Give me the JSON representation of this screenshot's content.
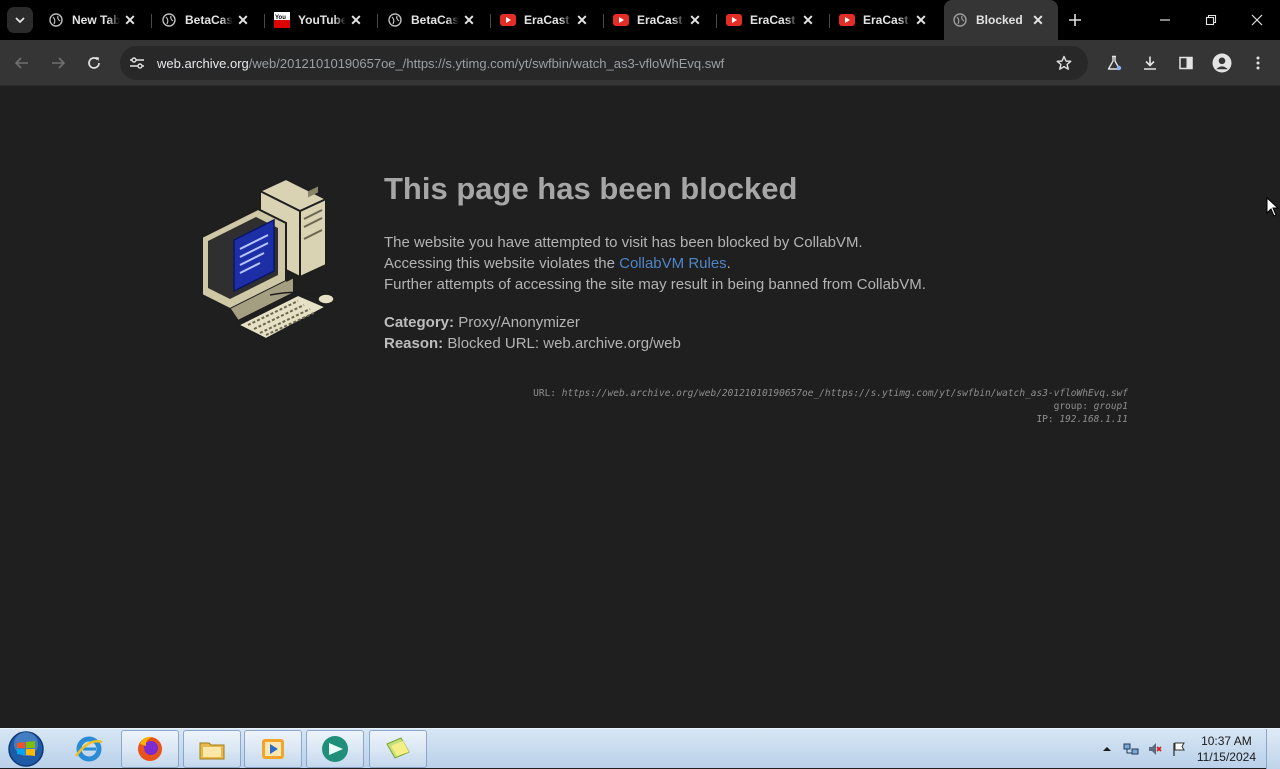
{
  "tabs": [
    {
      "title": "New Tab",
      "favicon": "globe-icon"
    },
    {
      "title": "BetaCast",
      "favicon": "globe-icon"
    },
    {
      "title": "YouTube",
      "favicon": "youtube-logo"
    },
    {
      "title": "BetaCast",
      "favicon": "globe-icon"
    },
    {
      "title": "EraCast",
      "favicon": "youtube-play-icon"
    },
    {
      "title": "EraCast",
      "favicon": "youtube-play-icon"
    },
    {
      "title": "EraCast",
      "favicon": "youtube-play-icon"
    },
    {
      "title": "EraCast",
      "favicon": "youtube-play-icon"
    },
    {
      "title": "Blocked",
      "favicon": "globe-icon",
      "active": true
    }
  ],
  "toolbar": {
    "url_host": "web.archive.org",
    "url_path": "/web/20121010190657oe_/https://s.ytimg.com/yt/swfbin/watch_as3-vfloWhEvq.swf"
  },
  "page": {
    "headline": "This page has been blocked",
    "line1": "The website you have attempted to visit has been blocked by CollabVM.",
    "line2_pre": "Accessing this website violates the ",
    "line2_link": "CollabVM Rules",
    "line2_post": ".",
    "line3": "Further attempts of accessing the site may result in being banned from CollabVM.",
    "category_label": "Category:",
    "category_value": "Proxy/Anonymizer",
    "reason_label": "Reason:",
    "reason_value": "Blocked URL: web.archive.org/web",
    "details": {
      "url_label": "URL:",
      "url_value": "https://web.archive.org/web/20121010190657oe_/https://s.ytimg.com/yt/swfbin/watch_as3-vfloWhEvq.swf",
      "group_label": "group:",
      "group_value": "group1",
      "ip_label": "IP:",
      "ip_value": "192.168.1.11"
    }
  },
  "taskbar": {
    "apps": [
      "internet-explorer",
      "firefox",
      "file-explorer",
      "media-player",
      "collabvm-app",
      "sticky-notes"
    ],
    "clock_time": "10:37 AM",
    "clock_date": "11/15/2024"
  },
  "colors": {
    "accent_link": "#4f86c6",
    "page_bg": "#1f1f1f",
    "toolbar_bg": "#353535"
  }
}
